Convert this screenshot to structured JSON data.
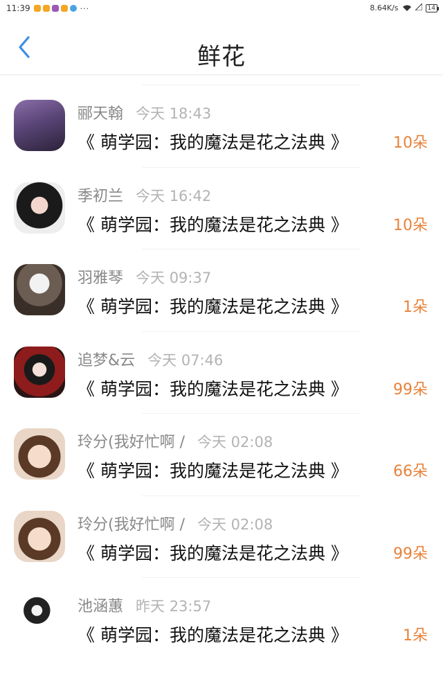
{
  "status_bar": {
    "time": "11:39",
    "more": "···",
    "speed": "8.64K/s",
    "battery": "14"
  },
  "header": {
    "title": "鲜花",
    "back_icon": "chevron-left-icon"
  },
  "colors": {
    "accent": "#3a8ee6",
    "count": "#e8823a",
    "name": "#888888",
    "time": "#b3b3b3"
  },
  "records": [
    {
      "user": "郦天翰",
      "time": "今天 18:43",
      "book": "《 萌学园：我的魔法是花之法典 》",
      "count": "10朵"
    },
    {
      "user": "季初兰",
      "time": "今天 16:42",
      "book": "《 萌学园：我的魔法是花之法典 》",
      "count": "10朵"
    },
    {
      "user": "羽雅琴",
      "time": "今天 09:37",
      "book": "《 萌学园：我的魔法是花之法典 》",
      "count": "1朵"
    },
    {
      "user": "追梦&云",
      "time": "今天 07:46",
      "book": "《 萌学园：我的魔法是花之法典 》",
      "count": "99朵"
    },
    {
      "user": "玲分(我好忙啊 /",
      "time": "今天 02:08",
      "book": "《 萌学园：我的魔法是花之法典 》",
      "count": "66朵"
    },
    {
      "user": "玲分(我好忙啊 /",
      "time": "今天 02:08",
      "book": "《 萌学园：我的魔法是花之法典 》",
      "count": "99朵"
    },
    {
      "user": "池涵蕙",
      "time": "昨天 23:57",
      "book": "《 萌学园：我的魔法是花之法典 》",
      "count": "1朵"
    }
  ]
}
